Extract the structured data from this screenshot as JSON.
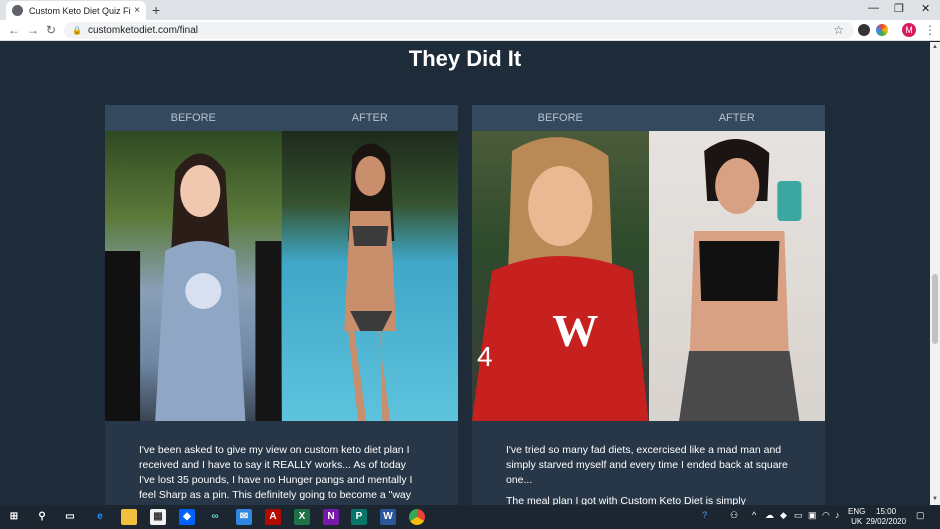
{
  "browser": {
    "tab_title": "Custom Keto Diet Quiz Final Page",
    "tab_close": "×",
    "new_tab": "+",
    "url": "customketodiet.com/final",
    "profile_initial": "M",
    "controls": {
      "minimize": "—",
      "restore": "❐",
      "close": "✕"
    }
  },
  "page": {
    "heading": "They Did It",
    "cards": [
      {
        "before_label": "BEFORE",
        "after_label": "AFTER",
        "testimonial": [
          "I've been asked to give my view on custom keto diet plan I received and I have to say it REALLY works... As of today I've lost 35 pounds, I have no Hunger pangs and mentally I feel Sharp as a pin. This definitely going to become a \"way"
        ]
      },
      {
        "before_label": "BEFORE",
        "after_label": "AFTER",
        "testimonial": [
          "I've tried so many fad diets, excercised like a mad man and simply starved myself and every time I ended back at square one...",
          "The meal plan I got with Custom Keto Diet is simply"
        ]
      }
    ]
  },
  "taskbar": {
    "language": "ENG",
    "region": "UK",
    "time": "15:00",
    "date": "29/02/2020",
    "apps": [
      "start-icon",
      "search-icon",
      "task-view-icon",
      "edge-icon",
      "file-explorer-icon",
      "store-icon",
      "dropbox-icon",
      "infinity-icon",
      "mail-icon",
      "acrobat-icon",
      "excel-icon",
      "onenote-icon",
      "publisher-icon",
      "word-icon",
      "chrome-icon"
    ]
  }
}
